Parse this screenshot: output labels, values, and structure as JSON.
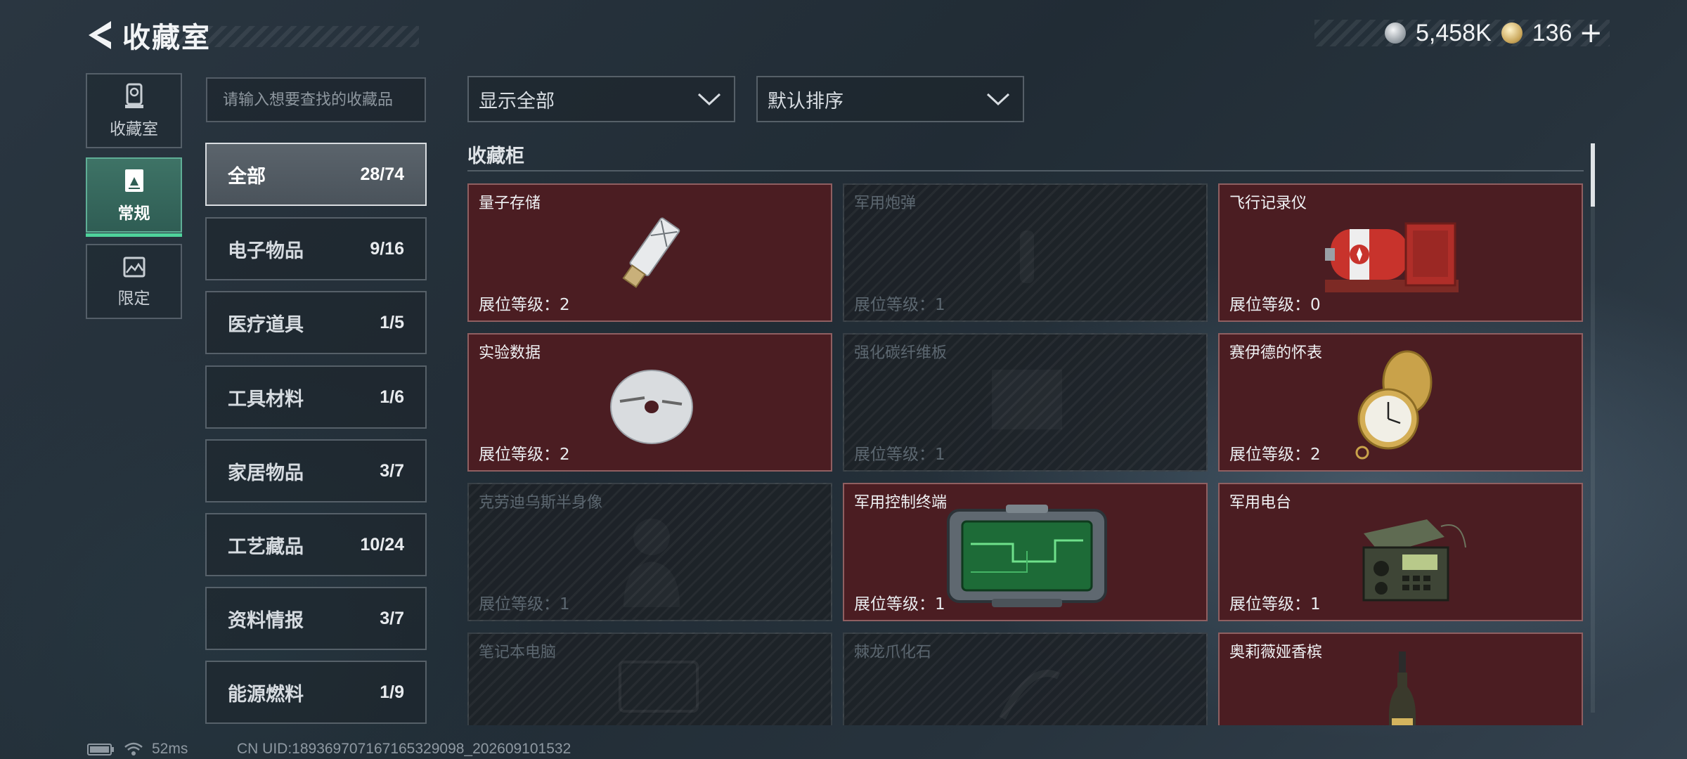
{
  "header": {
    "title": "收藏室",
    "currency_silver": "5,458K",
    "currency_gold": "136"
  },
  "left_tabs": [
    {
      "label": "收藏室",
      "icon": "trophy-icon"
    },
    {
      "label": "常规",
      "icon": "card-icon"
    },
    {
      "label": "限定",
      "icon": "landscape-icon"
    }
  ],
  "search": {
    "placeholder": "请输入想要查找的收藏品"
  },
  "categories": [
    {
      "name": "全部",
      "count": "28/74"
    },
    {
      "name": "电子物品",
      "count": "9/16"
    },
    {
      "name": "医疗道具",
      "count": "1/5"
    },
    {
      "name": "工具材料",
      "count": "1/6"
    },
    {
      "name": "家居物品",
      "count": "3/7"
    },
    {
      "name": "工艺藏品",
      "count": "10/24"
    },
    {
      "name": "资料情报",
      "count": "3/7"
    },
    {
      "name": "能源燃料",
      "count": "1/9"
    }
  ],
  "filters": {
    "show": "显示全部",
    "sort": "默认排序"
  },
  "section": {
    "title": "收藏柜"
  },
  "items": [
    {
      "name": "量子存储",
      "level": "展位等级：2",
      "unlocked": true,
      "icon": "usb-drive-icon"
    },
    {
      "name": "军用炮弹",
      "level": "展位等级：1",
      "unlocked": false,
      "icon": "shell-icon"
    },
    {
      "name": "飞行记录仪",
      "level": "展位等级：0",
      "unlocked": true,
      "icon": "flight-recorder-icon"
    },
    {
      "name": "实验数据",
      "level": "展位等级：2",
      "unlocked": true,
      "icon": "disc-icon"
    },
    {
      "name": "强化碳纤维板",
      "level": "展位等级：1",
      "unlocked": false,
      "icon": "carbon-plate-icon"
    },
    {
      "name": "赛伊德的怀表",
      "level": "展位等级：2",
      "unlocked": true,
      "icon": "pocket-watch-icon"
    },
    {
      "name": "克劳迪乌斯半身像",
      "level": "展位等级：1",
      "unlocked": false,
      "icon": "bust-icon"
    },
    {
      "name": "军用控制终端",
      "level": "展位等级：1",
      "unlocked": true,
      "icon": "control-terminal-icon"
    },
    {
      "name": "军用电台",
      "level": "展位等级：1",
      "unlocked": true,
      "icon": "radio-icon"
    },
    {
      "name": "笔记本电脑",
      "level": "",
      "unlocked": false,
      "icon": "laptop-icon"
    },
    {
      "name": "棘龙爪化石",
      "level": "",
      "unlocked": false,
      "icon": "fossil-icon"
    },
    {
      "name": "奥莉薇娅香槟",
      "level": "",
      "unlocked": true,
      "icon": "champagne-icon"
    }
  ],
  "footer": {
    "ping": "52ms",
    "uid": "CN UID:189369707167165329098_202609101532"
  }
}
